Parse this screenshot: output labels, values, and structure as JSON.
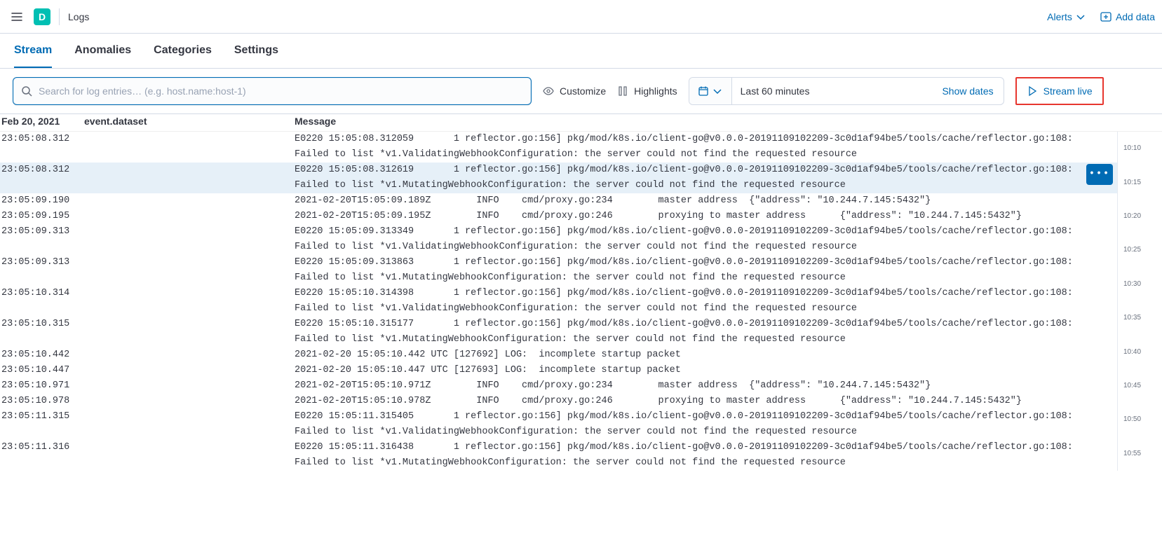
{
  "header": {
    "logo_letter": "D",
    "breadcrumb": "Logs",
    "alerts_label": "Alerts",
    "add_data_label": "Add data"
  },
  "tabs": [
    {
      "label": "Stream",
      "active": true
    },
    {
      "label": "Anomalies",
      "active": false
    },
    {
      "label": "Categories",
      "active": false
    },
    {
      "label": "Settings",
      "active": false
    }
  ],
  "toolbar": {
    "search_placeholder": "Search for log entries… (e.g. host.name:host-1)",
    "customize_label": "Customize",
    "highlights_label": "Highlights",
    "date_range_label": "Last 60 minutes",
    "show_dates_label": "Show dates",
    "stream_live_label": "Stream live"
  },
  "columns": {
    "date_header": "Feb 20, 2021",
    "dataset_header": "event.dataset",
    "message_header": "Message"
  },
  "log_rows": [
    {
      "ts": "23:05:08.312",
      "highlight": false,
      "has_menu": false,
      "msg": "E0220 15:05:08.312059       1 reflector.go:156] pkg/mod/k8s.io/client-go@v0.0.0-20191109102209-3c0d1af94be5/tools/cache/reflector.go:108: Failed to list *v1.ValidatingWebhookConfiguration: the server could not find the requested resource"
    },
    {
      "ts": "23:05:08.312",
      "highlight": true,
      "has_menu": true,
      "msg": "E0220 15:05:08.312619       1 reflector.go:156] pkg/mod/k8s.io/client-go@v0.0.0-20191109102209-3c0d1af94be5/tools/cache/reflector.go:108: Failed to list *v1.MutatingWebhookConfiguration: the server could not find the requested resource"
    },
    {
      "ts": "23:05:09.190",
      "highlight": false,
      "has_menu": false,
      "msg": "2021-02-20T15:05:09.189Z        INFO    cmd/proxy.go:234        master address  {\"address\": \"10.244.7.145:5432\"}"
    },
    {
      "ts": "23:05:09.195",
      "highlight": false,
      "has_menu": false,
      "msg": "2021-02-20T15:05:09.195Z        INFO    cmd/proxy.go:246        proxying to master address      {\"address\": \"10.244.7.145:5432\"}"
    },
    {
      "ts": "23:05:09.313",
      "highlight": false,
      "has_menu": false,
      "msg": "E0220 15:05:09.313349       1 reflector.go:156] pkg/mod/k8s.io/client-go@v0.0.0-20191109102209-3c0d1af94be5/tools/cache/reflector.go:108: Failed to list *v1.ValidatingWebhookConfiguration: the server could not find the requested resource"
    },
    {
      "ts": "23:05:09.313",
      "highlight": false,
      "has_menu": false,
      "msg": "E0220 15:05:09.313863       1 reflector.go:156] pkg/mod/k8s.io/client-go@v0.0.0-20191109102209-3c0d1af94be5/tools/cache/reflector.go:108: Failed to list *v1.MutatingWebhookConfiguration: the server could not find the requested resource"
    },
    {
      "ts": "23:05:10.314",
      "highlight": false,
      "has_menu": false,
      "msg": "E0220 15:05:10.314398       1 reflector.go:156] pkg/mod/k8s.io/client-go@v0.0.0-20191109102209-3c0d1af94be5/tools/cache/reflector.go:108: Failed to list *v1.ValidatingWebhookConfiguration: the server could not find the requested resource"
    },
    {
      "ts": "23:05:10.315",
      "highlight": false,
      "has_menu": false,
      "msg": "E0220 15:05:10.315177       1 reflector.go:156] pkg/mod/k8s.io/client-go@v0.0.0-20191109102209-3c0d1af94be5/tools/cache/reflector.go:108: Failed to list *v1.MutatingWebhookConfiguration: the server could not find the requested resource"
    },
    {
      "ts": "23:05:10.442",
      "highlight": false,
      "has_menu": false,
      "msg": "2021-02-20 15:05:10.442 UTC [127692] LOG:  incomplete startup packet"
    },
    {
      "ts": "23:05:10.447",
      "highlight": false,
      "has_menu": false,
      "msg": "2021-02-20 15:05:10.447 UTC [127693] LOG:  incomplete startup packet"
    },
    {
      "ts": "23:05:10.971",
      "highlight": false,
      "has_menu": false,
      "msg": "2021-02-20T15:05:10.971Z        INFO    cmd/proxy.go:234        master address  {\"address\": \"10.244.7.145:5432\"}"
    },
    {
      "ts": "23:05:10.978",
      "highlight": false,
      "has_menu": false,
      "msg": "2021-02-20T15:05:10.978Z        INFO    cmd/proxy.go:246        proxying to master address      {\"address\": \"10.244.7.145:5432\"}"
    },
    {
      "ts": "23:05:11.315",
      "highlight": false,
      "has_menu": false,
      "msg": "E0220 15:05:11.315405       1 reflector.go:156] pkg/mod/k8s.io/client-go@v0.0.0-20191109102209-3c0d1af94be5/tools/cache/reflector.go:108: Failed to list *v1.ValidatingWebhookConfiguration: the server could not find the requested resource"
    },
    {
      "ts": "23:05:11.316",
      "highlight": false,
      "has_menu": false,
      "msg": "E0220 15:05:11.316438       1 reflector.go:156] pkg/mod/k8s.io/client-go@v0.0.0-20191109102209-3c0d1af94be5/tools/cache/reflector.go:108: Failed to list *v1.MutatingWebhookConfiguration: the server could not find the requested resource"
    }
  ],
  "minimap": {
    "ticks": [
      "10:10",
      "10:15",
      "10:20",
      "10:25",
      "10:30",
      "10:35",
      "10:40",
      "10:45",
      "10:50",
      "10:55"
    ]
  }
}
